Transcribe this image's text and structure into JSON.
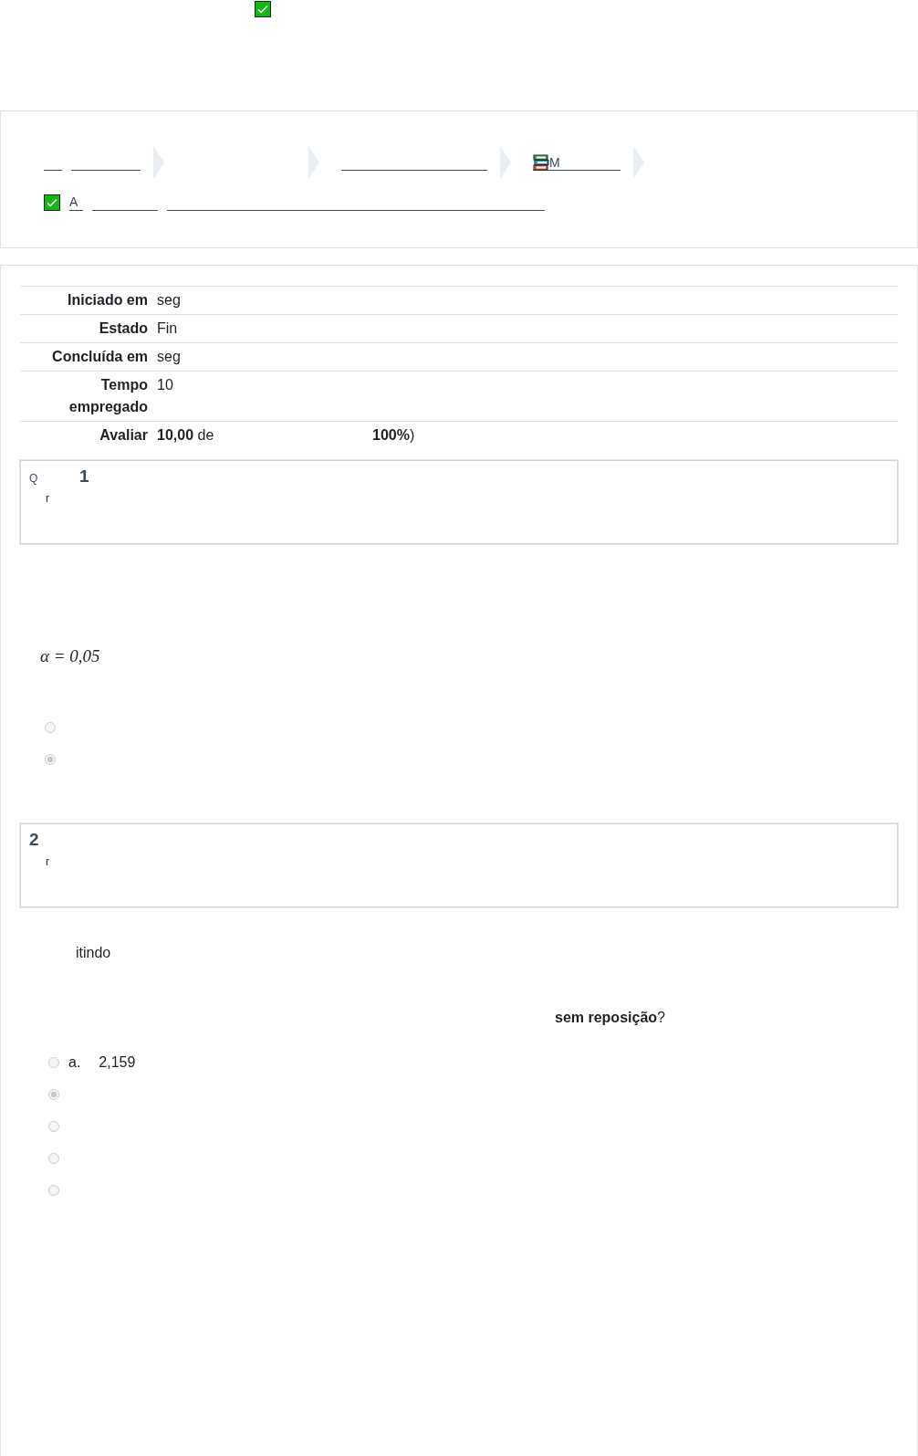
{
  "breadcrumb": {
    "items": [
      {
        "kind": "blank"
      },
      {
        "kind": "blank"
      },
      {
        "kind": "blank"
      },
      {
        "kind": "course",
        "label": "M"
      }
    ],
    "activity": {
      "label": "A"
    }
  },
  "summary": [
    {
      "label": "Iniciado em",
      "value": "seg"
    },
    {
      "label": "Estado",
      "value": "Fin"
    },
    {
      "label": "Concluída em",
      "value": "seg"
    },
    {
      "label": "Tempo empregado",
      "value": "10"
    },
    {
      "label": "Avaliar",
      "value": "**10,00** de",
      "extra": "**100%**)"
    }
  ],
  "questions": [
    {
      "prefix": "Q",
      "number": "1",
      "status": "r",
      "body": [
        {
          "kind": "math",
          "text": "α = 0,05"
        }
      ],
      "options": [
        {
          "selected": false
        },
        {
          "selected": true
        }
      ]
    },
    {
      "number": "2",
      "status": "r",
      "body": [
        {
          "kind": "text",
          "text": "itindo"
        },
        {
          "kind": "question",
          "text": "**sem reposição**?"
        }
      ],
      "options": [
        {
          "letter": "a.",
          "text": "2,159",
          "selected": false
        },
        {
          "selected": true
        },
        {
          "selected": false
        },
        {
          "selected": false
        },
        {
          "selected": false
        }
      ]
    }
  ]
}
